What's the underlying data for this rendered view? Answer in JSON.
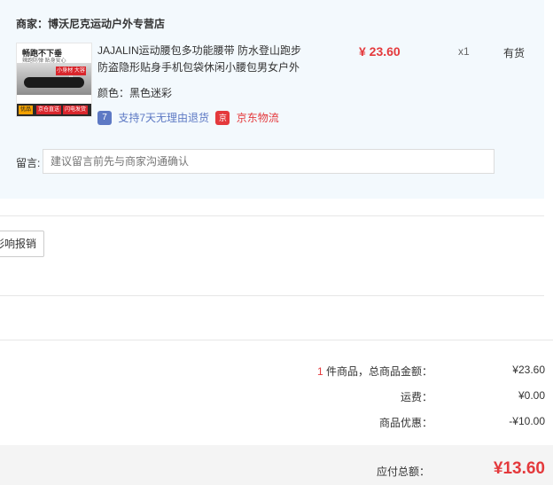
{
  "store": {
    "label": "商家：",
    "name": "博沃尼克运动户外专营店"
  },
  "product": {
    "image_text": {
      "headline": "畅跑不下垂",
      "sub": "辣跑防弹 贴身安心",
      "badge": "小身材 大容量",
      "tag1": "优品",
      "tag2": "京仓直送",
      "tag3": "闪电发货"
    },
    "title": "JAJALIN运动腰包多功能腰带 防水登山跑步防盗隐形贴身手机包袋休闲小腰包男女户外",
    "price": "¥ 23.60",
    "qty": "x1",
    "stock": "有货",
    "color_label": "颜色：",
    "color_value": "黑色迷彩",
    "service_icon_7": "7",
    "service_text_7": "支持7天无理由退货",
    "service_icon_jd": "京",
    "service_text_jd": "京东物流"
  },
  "remark": {
    "label": "留言:",
    "placeholder": "建议留言前先与商家沟通确认"
  },
  "invoice": {
    "button_label": "彩响报销"
  },
  "summary": {
    "count": "1",
    "count_suffix": " 件商品，总商品金额：",
    "goods_total": "¥23.60",
    "shipping_label": "运费：",
    "shipping_value": "¥0.00",
    "discount_label": "商品优惠：",
    "discount_value": "-¥10.00",
    "payable_label": "应付总额：",
    "payable_value": "¥13.60"
  },
  "colors": {
    "accent_red": "#e4393c",
    "panel_bg": "#f3f9fd",
    "service_blue": "#5d79c4"
  }
}
